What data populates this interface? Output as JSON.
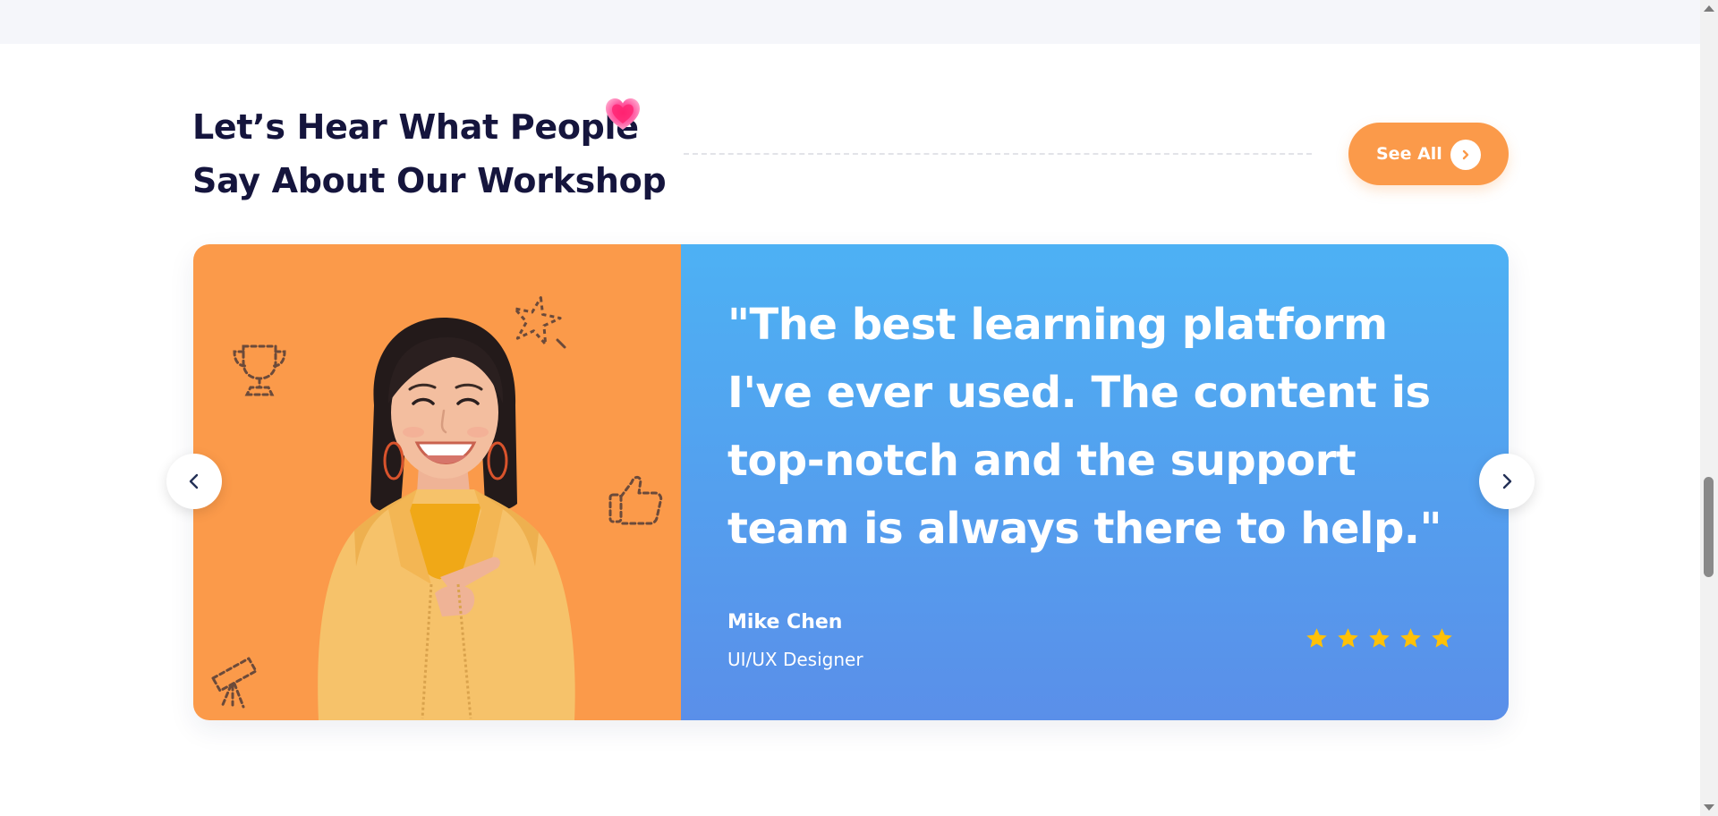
{
  "section": {
    "heading_line1": "Let’s Hear What People",
    "heading_line2": "Say About Our Workshop",
    "heading_icon": "heart-icon",
    "see_all_label": "See All",
    "see_all_icon": "chevron-right-icon"
  },
  "testimonial": {
    "quote": "\"The best learning platform I've ever used. The content is top-notch and the support team is always there to help.\"",
    "author_name": "Mike Chen",
    "author_role": "UI/UX Designer",
    "rating": 5,
    "rating_max": 5
  },
  "carousel": {
    "prev_icon": "chevron-left-icon",
    "next_icon": "chevron-right-icon"
  },
  "colors": {
    "accent_orange": "#fb9a4a",
    "card_blue_top": "#4db1f4",
    "card_blue_bottom": "#5a8fe9",
    "heading": "#15153d",
    "star": "#ffc107"
  }
}
